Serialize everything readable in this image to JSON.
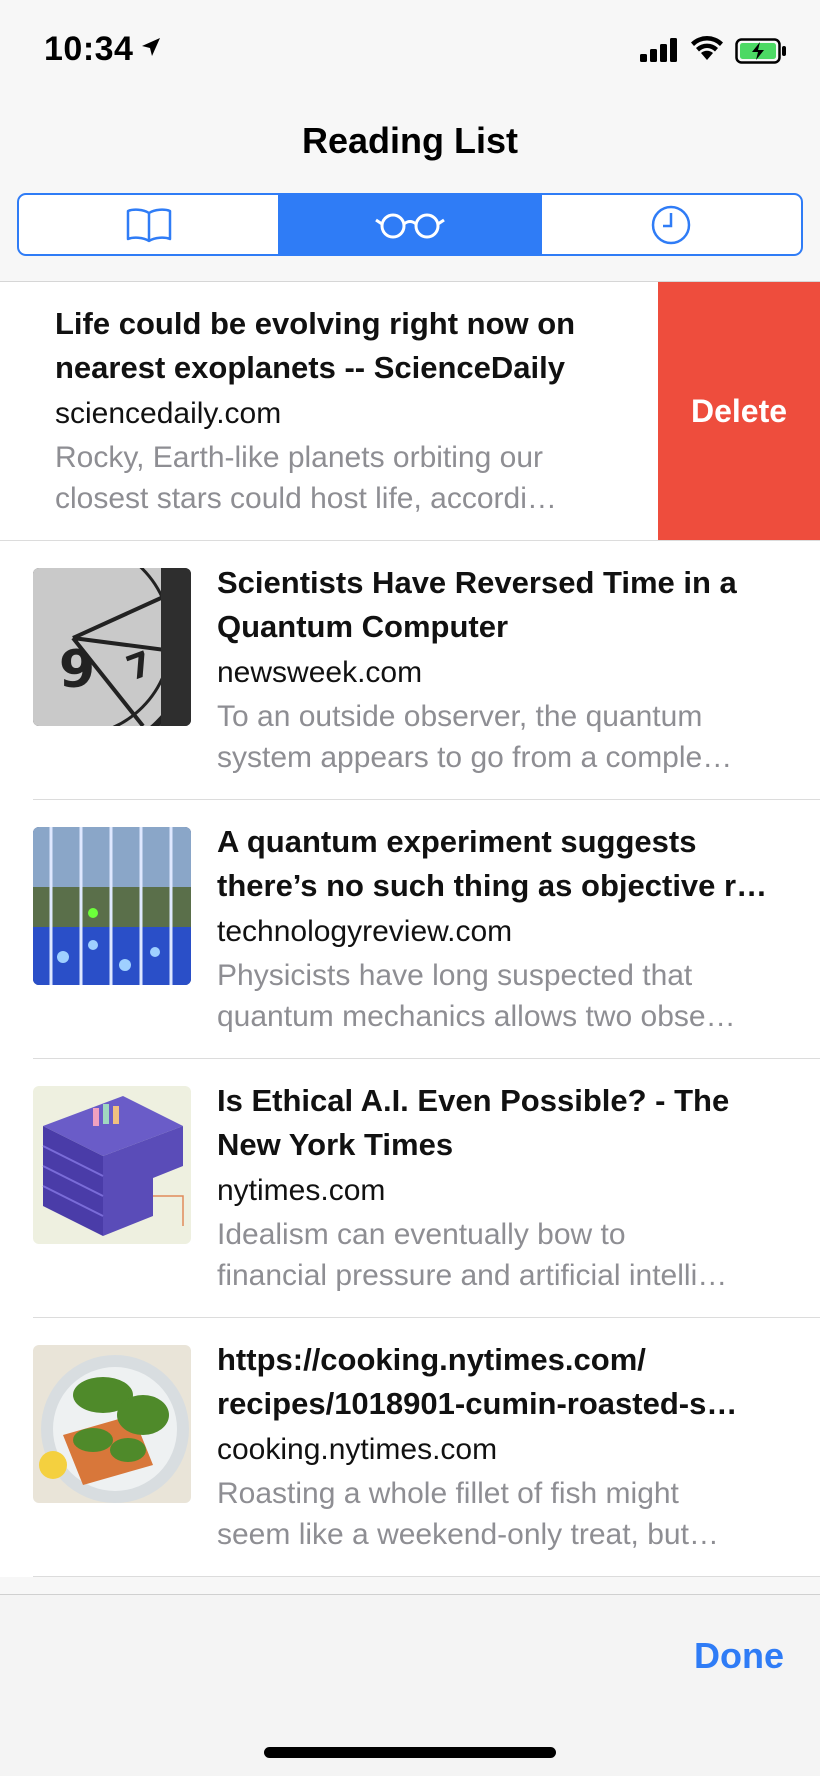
{
  "status_bar": {
    "time": "10:34",
    "icons": [
      "location-arrow-icon",
      "signal-icon",
      "wifi-icon",
      "battery-charging-icon"
    ]
  },
  "nav": {
    "title": "Reading List",
    "tabs": [
      {
        "icon": "book-icon",
        "name": "Bookmarks",
        "active": false
      },
      {
        "icon": "glasses-icon",
        "name": "Reading List",
        "active": true
      },
      {
        "icon": "clock-icon",
        "name": "History",
        "active": false
      }
    ]
  },
  "swiped_item": {
    "title_line1": "Life could be evolving right now on",
    "title_line2": "nearest exoplanets -- ScienceDaily",
    "domain": "sciencedaily.com",
    "excerpt_line1": "Rocky, Earth-like planets orbiting our",
    "excerpt_line2": "closest stars could host life, accordi…",
    "delete_label": "Delete"
  },
  "items": [
    {
      "title_line1": "Scientists Have Reversed Time in a",
      "title_line2": "Quantum Computer",
      "domain": "newsweek.com",
      "excerpt_line1": "To an outside observer, the quantum",
      "excerpt_line2": "system appears to go from a comple…"
    },
    {
      "title_line1": "A quantum experiment suggests",
      "title_line2": "there’s no such thing as objective r…",
      "domain": "technologyreview.com",
      "excerpt_line1": "Physicists have long suspected that",
      "excerpt_line2": "quantum mechanics allows two obse…"
    },
    {
      "title_line1": "Is Ethical A.I. Even Possible? - The",
      "title_line2": "New York Times",
      "domain": "nytimes.com",
      "excerpt_line1": "Idealism can eventually bow to",
      "excerpt_line2": "financial pressure and artificial intelli…"
    },
    {
      "title_line1": "https://cooking.nytimes.com/",
      "title_line2": "recipes/1018901-cumin-roasted-s…",
      "domain": "cooking.nytimes.com",
      "excerpt_line1": "Roasting a whole fillet of fish might",
      "excerpt_line2": "seem like a weekend-only treat, but…"
    }
  ],
  "bottom": {
    "done_label": "Done"
  },
  "colors": {
    "accent": "#2f7cf6",
    "delete": "#ee4d3d",
    "secondary_text": "#8e8e93"
  }
}
